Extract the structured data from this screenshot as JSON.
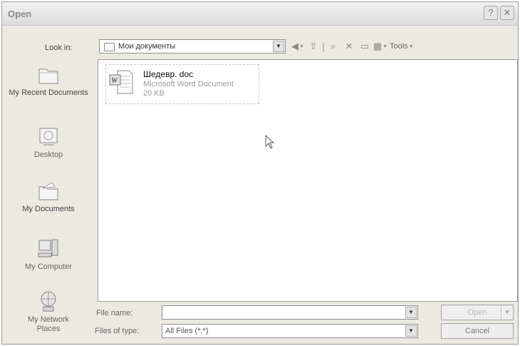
{
  "window": {
    "title": "Open",
    "help_label": "?",
    "close_label": "✕"
  },
  "look_in": {
    "label": "Look in:",
    "value": "Мои документы"
  },
  "toolbar": {
    "tools_label": "Tools"
  },
  "places": [
    {
      "label": "My Recent Documents",
      "icon": "recent-documents-icon"
    },
    {
      "label": "Desktop",
      "icon": "desktop-icon"
    },
    {
      "label": "My Documents",
      "icon": "my-documents-icon"
    },
    {
      "label": "My Computer",
      "icon": "my-computer-icon"
    },
    {
      "label": "My Network Places",
      "icon": "network-places-icon"
    }
  ],
  "files": [
    {
      "name": "Шедевр. doc",
      "type": "Microsoft Word Document",
      "size": "20 KB",
      "icon": "word-document-icon"
    }
  ],
  "file_name": {
    "label": "File name:",
    "value": ""
  },
  "files_of_type": {
    "label": "Files of type:",
    "value": "All Files (*.*)"
  },
  "buttons": {
    "open": "Open",
    "cancel": "Cancel"
  },
  "colors": {
    "dialog_bg": "#ece9e3",
    "list_bg": "#ffffff",
    "border": "#9a9a9a"
  }
}
